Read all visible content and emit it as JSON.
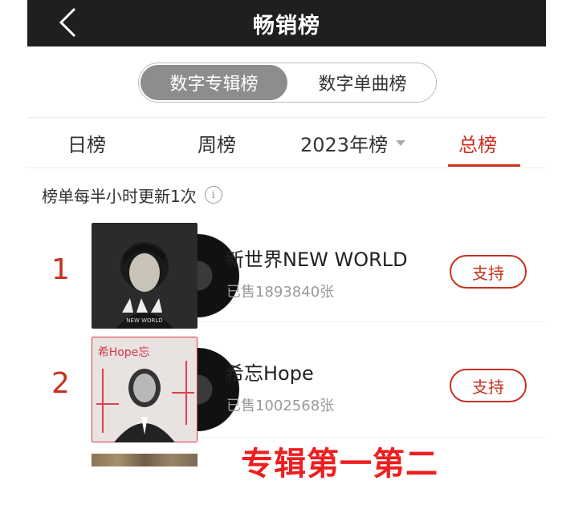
{
  "header": {
    "title": "畅销榜",
    "back_icon": "chevron-left-icon"
  },
  "segment": {
    "items": [
      {
        "label": "数字专辑榜",
        "active": true
      },
      {
        "label": "数字单曲榜",
        "active": false
      }
    ]
  },
  "tabs": [
    {
      "label": "日榜",
      "active": false
    },
    {
      "label": "周榜",
      "active": false
    },
    {
      "label": "2023年榜",
      "active": false,
      "has_dropdown": true
    },
    {
      "label": "总榜",
      "active": true
    }
  ],
  "note": {
    "text": "榜单每半小时更新1次",
    "icon": "info-icon"
  },
  "albums": [
    {
      "rank": "1",
      "name": "新世界NEW WORLD",
      "sold": "已售1893840张",
      "support_label": "支持",
      "cover_text": "NEW WORLD"
    },
    {
      "rank": "2",
      "name": "希忘Hope",
      "sold": "已售1002568张",
      "support_label": "支持",
      "cover_text": "希Hope忘"
    }
  ],
  "overlay": {
    "text": "专辑第一第二"
  },
  "colors": {
    "accent": "#c8311f",
    "topbar": "#1f1f1f",
    "overlay": "#ee1f1f"
  }
}
